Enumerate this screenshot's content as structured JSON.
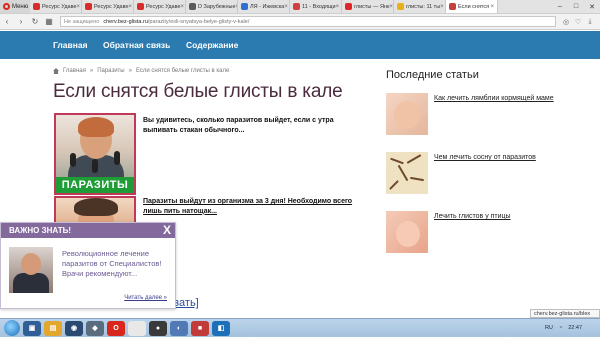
{
  "browser": {
    "menu_label": "Меню",
    "tabs": [
      {
        "label": "Ресурс Удаве",
        "color": "#d92b2b"
      },
      {
        "label": "Ресурс Удаве",
        "color": "#d92b2b"
      },
      {
        "label": "Ресурс Удаве",
        "color": "#d92b2b"
      },
      {
        "label": "D Зарубежные",
        "color": "#5a5a5a"
      },
      {
        "label": "ЛЯ - Ижевска",
        "color": "#2e6fd0"
      },
      {
        "label": "11 - Входящи",
        "color": "#d03f3f"
      },
      {
        "label": "глисты — Янк",
        "color": "#e0262b"
      },
      {
        "label": "глисты: 11 ты",
        "color": "#e8b01b"
      },
      {
        "label": "Если снятся",
        "color": "#c3423f"
      }
    ],
    "url_warning": "Не защищено",
    "url_host": "cherv.bez-glista.ru",
    "url_path": "/parazity/esli-snyatsya-belye-glisty-v-kale/"
  },
  "nav": {
    "items": [
      "Главная",
      "Обратная связь",
      "Содержание"
    ]
  },
  "breadcrumb": {
    "home": "Главная",
    "section": "Паразиты",
    "current": "Если снятся белые глисты в кале"
  },
  "article": {
    "title": "Если снятся белые глисты в кале",
    "promo1_label": "ПАРАЗИТЫ",
    "promo1_text": "Вы удивитесь, сколько паразитов выйдет, если с утра выпивать стакан обычного...",
    "promo2_text": "Паразиты выйдут из организма за 3 дня! Необходимо всего лишь пить натощак...",
    "partial_link": "азать]"
  },
  "sidebar": {
    "title": "Последние статьи",
    "items": [
      {
        "label": "Как лечить лямблии кормящей маме"
      },
      {
        "label": "Чем лечить сосну от паразитов"
      },
      {
        "label": "Лечить глистов у птицы"
      }
    ]
  },
  "popup": {
    "title": "ВАЖНО ЗНАТЬ!",
    "close": "X",
    "text": "Революционное лечение паразитов от Специалистов! Врачи рекомендуют...",
    "more": "Читать далее »"
  },
  "taskbar": {
    "lang": "RU",
    "time": "22:47"
  },
  "status_url": "cherv.bez-glista.ru/blex"
}
